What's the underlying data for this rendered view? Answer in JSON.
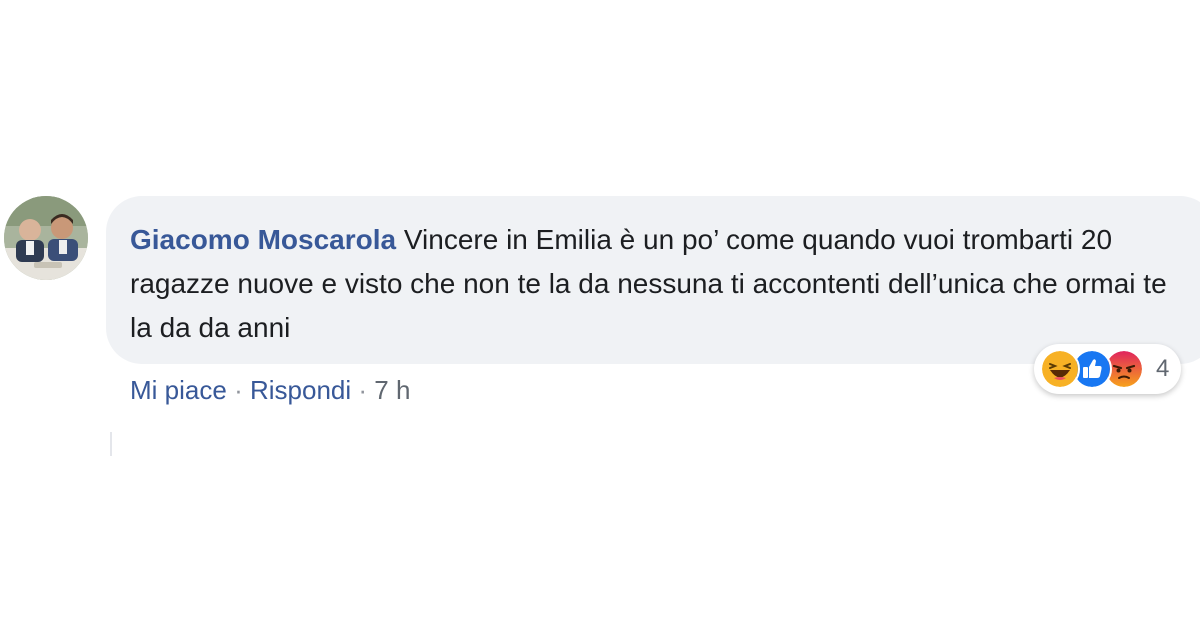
{
  "comment": {
    "author": "Giacomo Moscarola",
    "text": "Vincere in Emilia è un po’ come quando vuoi trombarti 20 ragazze nuove e visto che non te la da nessuna ti accontenti dell’unica che ormai te la da da anni",
    "actions": {
      "like_label": "Mi piace",
      "reply_label": "Rispondi",
      "separator": "·",
      "timestamp": "7 h"
    },
    "reactions": {
      "icons": [
        "haha-icon",
        "like-icon",
        "angry-icon"
      ],
      "count": "4"
    }
  },
  "colors": {
    "author": "#385898",
    "bubble_background": "#f0f2f5",
    "text": "#1c1e21",
    "meta": "#606770",
    "like_blue": "#1877f2",
    "haha_yellow": "#f7b125",
    "angry_orange": "#e9710f"
  }
}
